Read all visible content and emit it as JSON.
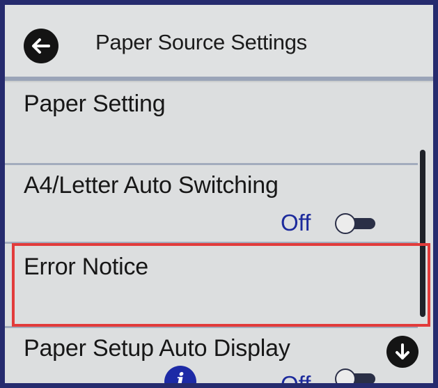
{
  "header": {
    "title": "Paper Source Settings",
    "back_icon": "arrow-left-icon"
  },
  "menu": {
    "items": [
      {
        "label": "Paper Setting"
      },
      {
        "label": "A4/Letter Auto Switching",
        "value": "Off",
        "toggle_on": false
      },
      {
        "label": "Error Notice",
        "highlighted": true
      },
      {
        "label": "Paper Setup Auto Display",
        "value": "Off",
        "toggle_on": false,
        "info_icon": "info-icon"
      }
    ]
  },
  "scroll": {
    "down_icon": "arrow-down-icon"
  },
  "colors": {
    "frame": "#262b6e",
    "screen": "#dcdedf",
    "value_text": "#1c2a9c",
    "highlight": "#e23b3b",
    "info": "#1d2aa6"
  }
}
